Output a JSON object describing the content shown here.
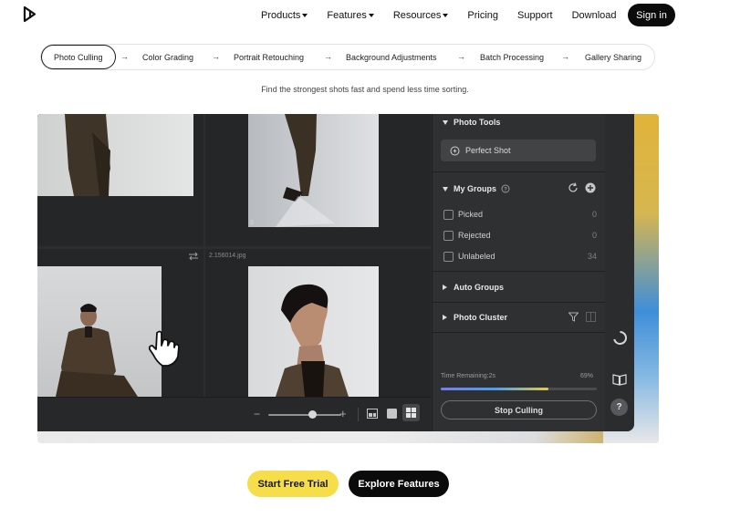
{
  "nav": {
    "links": [
      {
        "label": "Products",
        "has_menu": true
      },
      {
        "label": "Features",
        "has_menu": true
      },
      {
        "label": "Resources",
        "has_menu": true
      },
      {
        "label": "Pricing",
        "has_menu": false
      },
      {
        "label": "Support",
        "has_menu": false
      },
      {
        "label": "Download",
        "has_menu": false
      }
    ],
    "signin_label": "Sign in"
  },
  "tabs": [
    {
      "label": "Photo Culling",
      "active": true
    },
    {
      "label": "Color Grading",
      "active": false
    },
    {
      "label": "Portrait Retouching",
      "active": false
    },
    {
      "label": "Background Adjustments",
      "active": false
    },
    {
      "label": "Batch Processing",
      "active": false
    },
    {
      "label": "Gallery Sharing",
      "active": false
    }
  ],
  "tab_separator": "→",
  "tagline": "Find the strongest shots fast and spend less time sorting.",
  "app": {
    "grid": {
      "cell_number": "8",
      "filename": "2.156014.jpg"
    },
    "panel": {
      "photo_tools": "Photo Tools",
      "perfect_shot": "Perfect Shot",
      "my_groups": "My Groups",
      "groups": [
        {
          "label": "Picked",
          "count": "0"
        },
        {
          "label": "Rejected",
          "count": "0"
        },
        {
          "label": "Unlabeled",
          "count": "34"
        }
      ],
      "auto_groups": "Auto Groups",
      "photo_cluster": "Photo Cluster",
      "time_remaining": "Time Remaining:2s",
      "percent": "69%",
      "progress": 0.69,
      "stop_label": "Stop Culling"
    },
    "rail": {
      "help": "?"
    }
  },
  "cta": {
    "trial_label": "Start Free Trial",
    "explore_label": "Explore Features"
  },
  "colors": {
    "accent_yellow": "#f5de4a",
    "dark": "#0b0b0b",
    "app_bg": "#2a2c2e"
  }
}
